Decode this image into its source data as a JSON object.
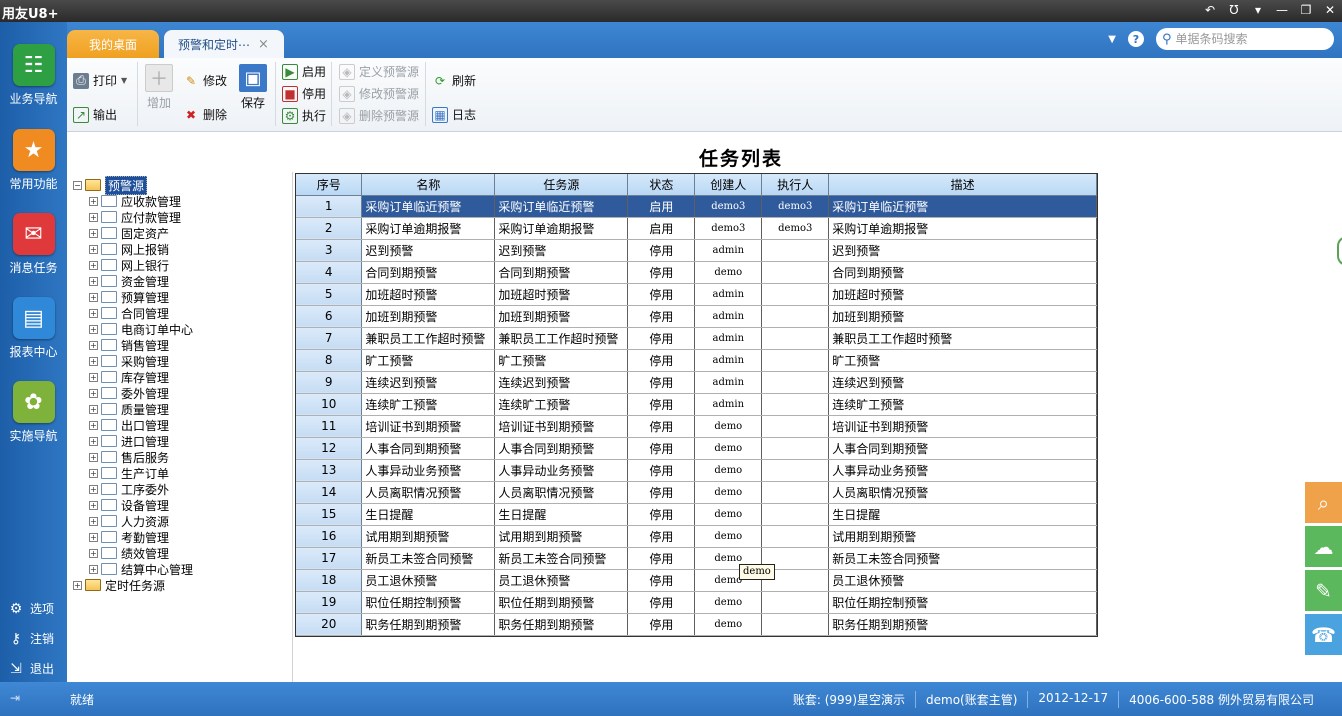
{
  "app": {
    "logo": "用友U8+",
    "window_buttons": [
      "↶",
      "Ʊ",
      "▾",
      "—",
      "❐",
      "✕"
    ]
  },
  "leftnav": {
    "items": [
      {
        "label": "业务导航",
        "icon": "business-nav-icon",
        "color": "#2ea043",
        "glyph": "☷"
      },
      {
        "label": "常用功能",
        "icon": "star-icon",
        "color": "#f08b21",
        "glyph": "★"
      },
      {
        "label": "消息任务",
        "icon": "message-icon",
        "color": "#e0393b",
        "glyph": "✉"
      },
      {
        "label": "报表中心",
        "icon": "report-icon",
        "color": "#2f89d8",
        "glyph": "▤"
      },
      {
        "label": "实施导航",
        "icon": "compass-icon",
        "color": "#7fb23a",
        "glyph": "✿"
      }
    ],
    "bottom": [
      {
        "label": "选项",
        "icon": "gear-icon",
        "glyph": "⚙"
      },
      {
        "label": "注销",
        "icon": "key-icon",
        "glyph": "⚷"
      },
      {
        "label": "退出",
        "icon": "exit-icon",
        "glyph": "⇲"
      }
    ]
  },
  "tabs": {
    "home": "我的桌面",
    "alert": "预警和定时⋯",
    "close": "×"
  },
  "search": {
    "placeholder": "单据条码搜索"
  },
  "toolbar": {
    "print": "打印",
    "export": "输出",
    "add": "增加",
    "edit": "修改",
    "delete": "删除",
    "save": "保存",
    "enable": "启用",
    "disable": "停用",
    "execute": "执行",
    "define_source": "定义预警源",
    "modify_source": "修改预警源",
    "delete_source": "删除预警源",
    "refresh": "刷新",
    "log": "日志"
  },
  "page_title": "任务列表",
  "tree": {
    "root": "预警源",
    "children": [
      "应收款管理",
      "应付款管理",
      "固定资产",
      "网上报销",
      "网上银行",
      "资金管理",
      "预算管理",
      "合同管理",
      "电商订单中心",
      "销售管理",
      "采购管理",
      "库存管理",
      "委外管理",
      "质量管理",
      "出口管理",
      "进口管理",
      "售后服务",
      "生产订单",
      "工序委外",
      "设备管理",
      "人力资源",
      "考勤管理",
      "绩效管理",
      "结算中心管理"
    ],
    "root2": "定时任务源"
  },
  "grid": {
    "columns": [
      "序号",
      "名称",
      "任务源",
      "状态",
      "创建人",
      "执行人",
      "描述"
    ],
    "rows": [
      [
        "1",
        "采购订单临近预警",
        "采购订单临近预警",
        "启用",
        "demo3",
        "demo3",
        "采购订单临近预警"
      ],
      [
        "2",
        "采购订单逾期报警",
        "采购订单逾期报警",
        "启用",
        "demo3",
        "demo3",
        "采购订单逾期报警"
      ],
      [
        "3",
        "迟到预警",
        "迟到预警",
        "停用",
        "admin",
        "",
        "迟到预警"
      ],
      [
        "4",
        "合同到期预警",
        "合同到期预警",
        "停用",
        "demo",
        "",
        "合同到期预警"
      ],
      [
        "5",
        "加班超时预警",
        "加班超时预警",
        "停用",
        "admin",
        "",
        "加班超时预警"
      ],
      [
        "6",
        "加班到期预警",
        "加班到期预警",
        "停用",
        "admin",
        "",
        "加班到期预警"
      ],
      [
        "7",
        "兼职员工工作超时预警",
        "兼职员工工作超时预警",
        "停用",
        "admin",
        "",
        "兼职员工工作超时预警"
      ],
      [
        "8",
        "旷工预警",
        "旷工预警",
        "停用",
        "admin",
        "",
        "旷工预警"
      ],
      [
        "9",
        "连续迟到预警",
        "连续迟到预警",
        "停用",
        "admin",
        "",
        "连续迟到预警"
      ],
      [
        "10",
        "连续旷工预警",
        "连续旷工预警",
        "停用",
        "admin",
        "",
        "连续旷工预警"
      ],
      [
        "11",
        "培训证书到期预警",
        "培训证书到期预警",
        "停用",
        "demo",
        "",
        "培训证书到期预警"
      ],
      [
        "12",
        "人事合同到期预警",
        "人事合同到期预警",
        "停用",
        "demo",
        "",
        "人事合同到期预警"
      ],
      [
        "13",
        "人事异动业务预警",
        "人事异动业务预警",
        "停用",
        "demo",
        "",
        "人事异动业务预警"
      ],
      [
        "14",
        "人员离职情况预警",
        "人员离职情况预警",
        "停用",
        "demo",
        "",
        "人员离职情况预警"
      ],
      [
        "15",
        "生日提醒",
        "生日提醒",
        "停用",
        "demo",
        "",
        "生日提醒"
      ],
      [
        "16",
        "试用期到期预警",
        "试用期到期预警",
        "停用",
        "demo",
        "",
        "试用期到期预警"
      ],
      [
        "17",
        "新员工未签合同预警",
        "新员工未签合同预警",
        "停用",
        "demo",
        "",
        "新员工未签合同预警"
      ],
      [
        "18",
        "员工退休预警",
        "员工退休预警",
        "停用",
        "demo",
        "",
        "员工退休预警"
      ],
      [
        "19",
        "职位任期控制预警",
        "职位任期到期预警",
        "停用",
        "demo",
        "",
        "职位任期控制预警"
      ],
      [
        "20",
        "职务任期到期预警",
        "职务任期到期预警",
        "停用",
        "demo",
        "",
        "职务任期到期预警"
      ]
    ],
    "selected_row": 1,
    "tooltip": "demo"
  },
  "rightpanel": [
    {
      "icon": "search-icon",
      "color": "#f0a24a",
      "glyph": "⌕"
    },
    {
      "icon": "cloud-icon",
      "color": "#5cb85c",
      "glyph": "☁"
    },
    {
      "icon": "chat-icon",
      "color": "#5cb85c",
      "glyph": "✎"
    },
    {
      "icon": "service-icon",
      "color": "#4aa3df",
      "glyph": "☎"
    }
  ],
  "statusbar": {
    "ready": "就绪",
    "account": "账套: (999)星空演示",
    "user": "demo(账套主管)",
    "date": "2012-12-17",
    "company": "4006-600-588 例外贸易有限公司"
  }
}
